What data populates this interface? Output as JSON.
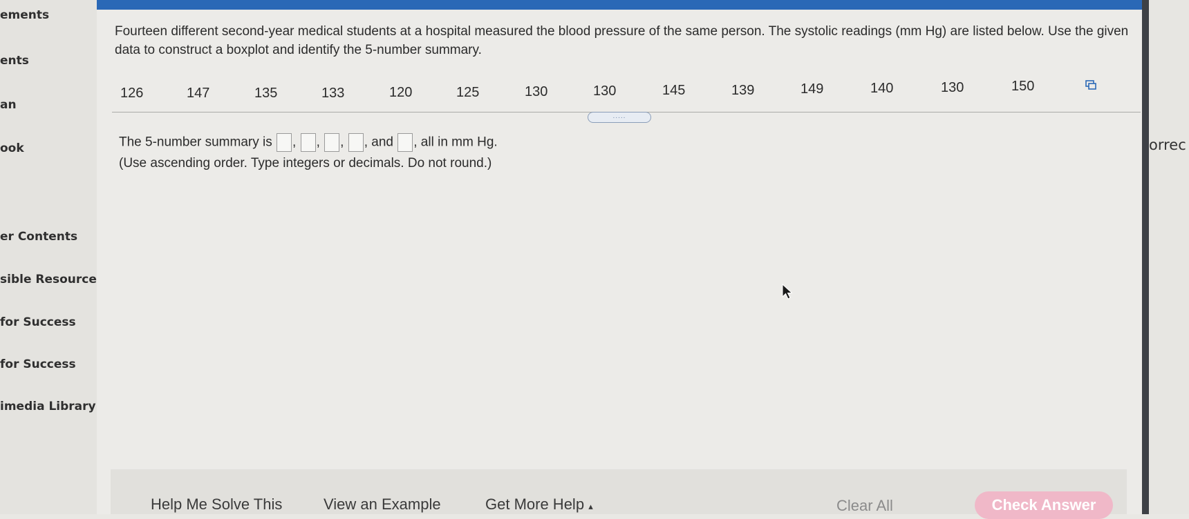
{
  "sidebar": {
    "items": [
      {
        "label": "ements"
      },
      {
        "label": "ents"
      },
      {
        "label": "an"
      },
      {
        "label": "ook"
      },
      {
        "label": "er Contents"
      },
      {
        "label": "sible Resources"
      },
      {
        "label": "for Success"
      },
      {
        "label": "for Success"
      },
      {
        "label": "imedia Library"
      }
    ]
  },
  "right_side": {
    "label": "orrec"
  },
  "question": {
    "text": "Fourteen different second-year medical students at a hospital measured the blood pressure of the same person. The systolic readings (mm Hg) are listed below. Use the given data to construct a boxplot and identify the 5-number summary.",
    "data_values": [
      "126",
      "147",
      "135",
      "133",
      "120",
      "125",
      "130",
      "130",
      "145",
      "139",
      "149",
      "140",
      "130",
      "150"
    ]
  },
  "answer": {
    "prefix": "The 5-number summary is",
    "sep": ",",
    "and": "and",
    "suffix": ", all in mm Hg.",
    "instructions": "(Use ascending order. Type integers or decimals. Do not round.)"
  },
  "handle": {
    "label": "....."
  },
  "bottom": {
    "help_solve": "Help Me Solve This",
    "view_example": "View an Example",
    "more_help": "Get More Help",
    "more_help_arrow": "▴",
    "clear_all": "Clear All",
    "check_answer": "Check Answer"
  },
  "icons": [
    "expand-data-icon",
    "mouse-cursor-icon"
  ]
}
